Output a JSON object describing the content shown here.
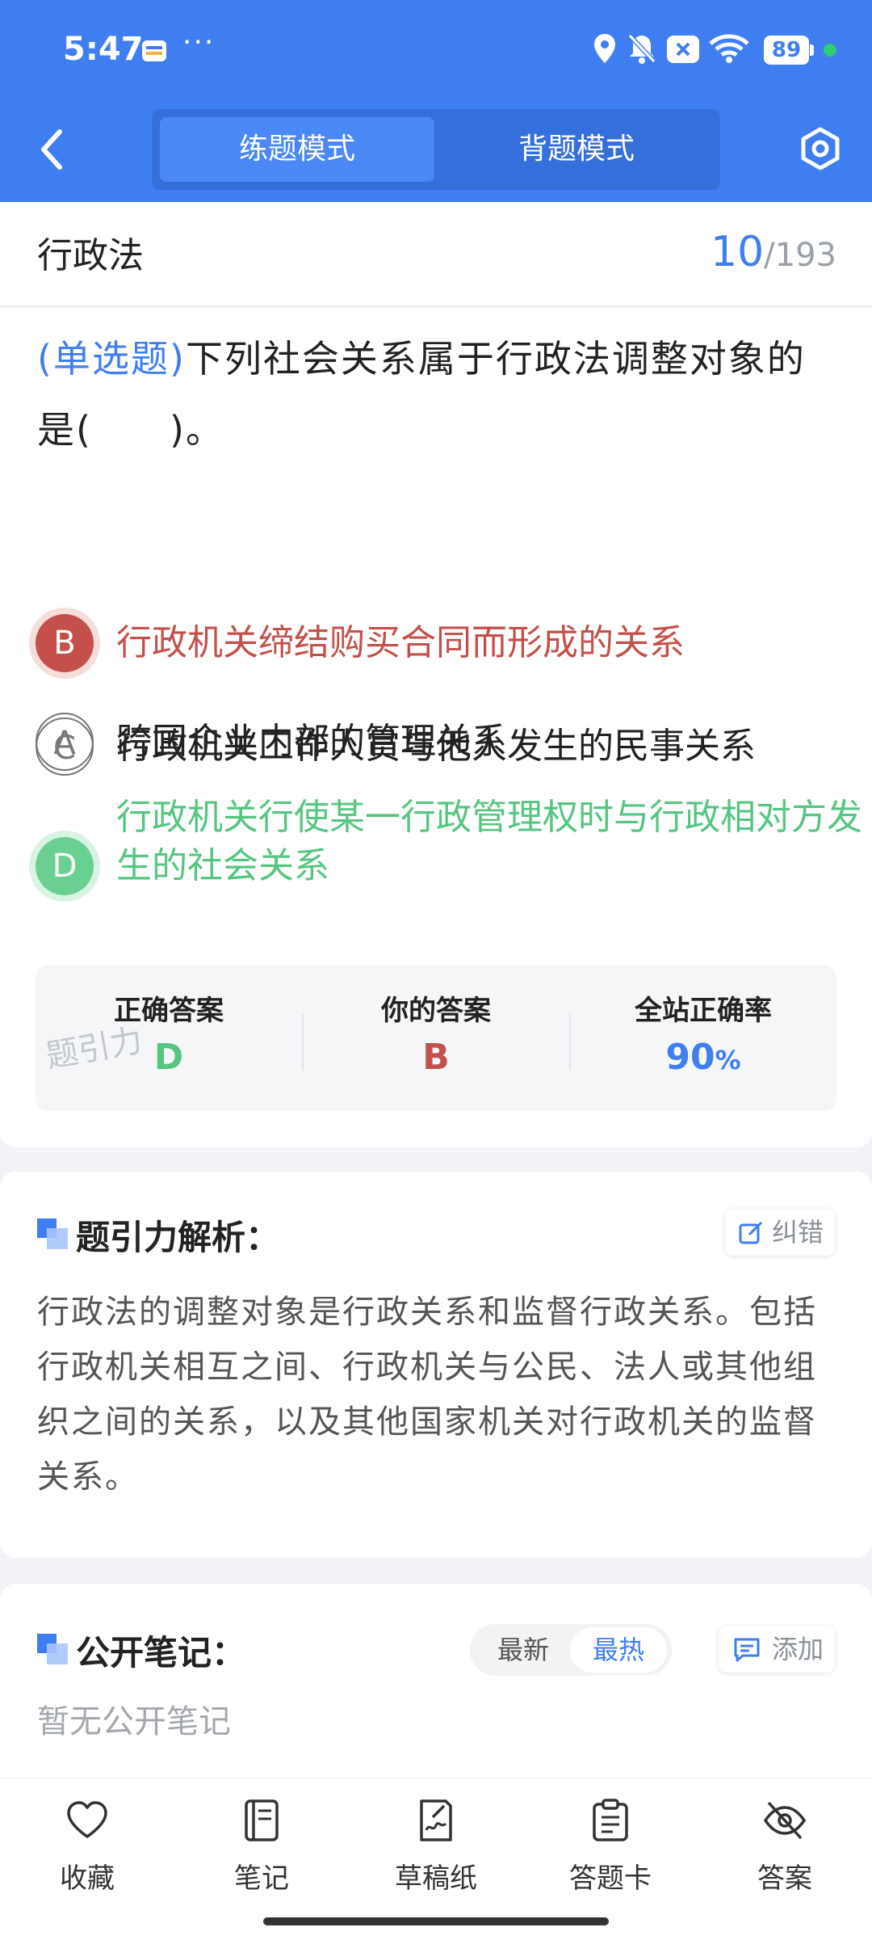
{
  "status_bar": {
    "time": "5:47",
    "dots": "···",
    "battery": "89"
  },
  "header": {
    "tabs": [
      {
        "label": "练题模式",
        "active": true
      },
      {
        "label": "背题模式",
        "active": false
      }
    ]
  },
  "question": {
    "subject": "行政法",
    "current": "10",
    "total": "/193",
    "type": "(单选题)",
    "text": "下列社会关系属于行政法调整对象的是(　　)。",
    "options": [
      {
        "letter": "A",
        "text": "跨国企业内部的管理关系",
        "state": "normal"
      },
      {
        "letter": "B",
        "text": "行政机关缔结购买合同而形成的关系",
        "state": "wrong"
      },
      {
        "letter": "C",
        "text": "行政机关工作人员与他人发生的民事关系",
        "state": "normal"
      },
      {
        "letter": "D",
        "text": "行政机关行使某一行政管理权时与行政相对方发生的社会关系",
        "state": "right"
      }
    ]
  },
  "answer_summary": {
    "correct_label": "正确答案",
    "correct_value": "D",
    "yours_label": "你的答案",
    "yours_value": "B",
    "rate_label": "全站正确率",
    "rate_value": "90",
    "rate_unit": "%",
    "watermark": "题引力"
  },
  "analysis": {
    "title": "题引力解析：",
    "correct_btn": "纠错",
    "text": "行政法的调整对象是行政关系和监督行政关系。包括行政机关相互之间、行政机关与公民、法人或其他组织之间的关系，以及其他国家机关对行政机关的监督关系。"
  },
  "notes": {
    "title": "公开笔记：",
    "sort_newest": "最新",
    "sort_hottest": "最热",
    "add_btn": "添加",
    "empty": "暂无公开笔记"
  },
  "bottom_nav": [
    "收藏",
    "笔记",
    "草稿纸",
    "答题卡",
    "答案"
  ],
  "colors": {
    "primary": "#3f7ef0",
    "wrong": "#c4504b",
    "right": "#55c582"
  }
}
